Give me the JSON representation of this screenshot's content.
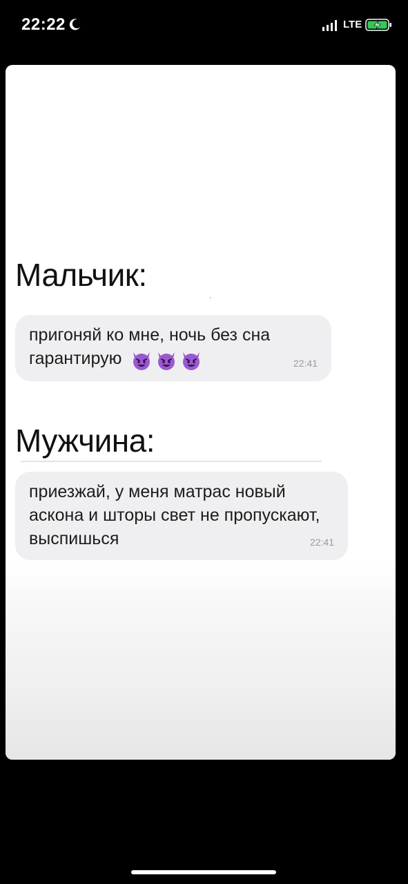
{
  "status_bar": {
    "time": "22:22",
    "network": "LTE",
    "icons": [
      "moon-icon",
      "signal-icon",
      "battery-charging-icon"
    ]
  },
  "post": {
    "boy": {
      "speaker": "Мальчик:",
      "message_line1": "пригоняй ко мне, ночь без сна",
      "message_line2": "гарантирую",
      "emoji": [
        "smiling-devil-icon",
        "smiling-devil-icon",
        "smiling-devil-icon"
      ],
      "time": "22:41"
    },
    "man": {
      "speaker": "Мужчина:",
      "message": "приезжай, у меня матрас новый аскона и шторы свет не пропускают, выспишься",
      "time": "22:41"
    }
  },
  "colors": {
    "screen_background": "#000000",
    "card_background": "#ffffff",
    "bubble_background": "#efeff1",
    "message_text": "#1c1c1c",
    "timestamp_text": "#9a9a9a",
    "emoji_purple": "#8e4fc8"
  }
}
